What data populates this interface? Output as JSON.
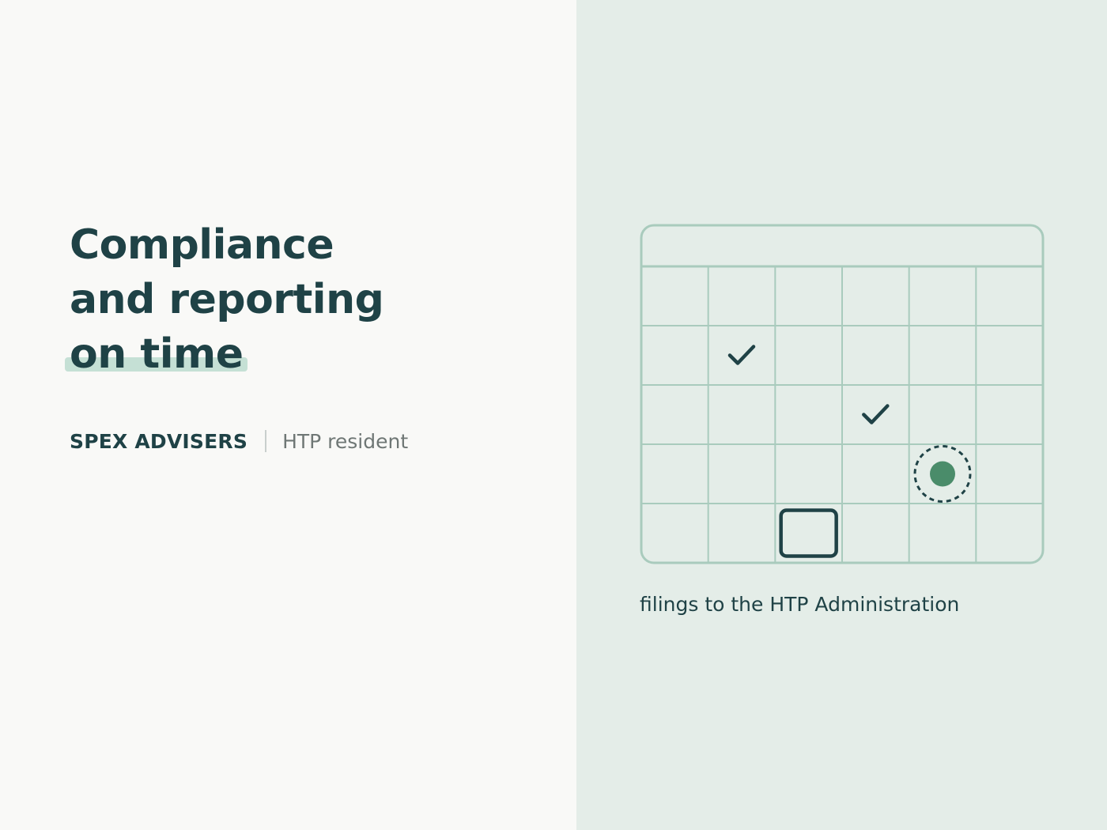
{
  "headline": {
    "line1": "Compliance",
    "line2": "and reporting",
    "line3": "on time"
  },
  "brand": {
    "name": "SPEX ADVISERS",
    "tag": "HTP resident"
  },
  "illustration": {
    "caption": "filings to the HTP Administration",
    "calendar": {
      "columns": 6,
      "rows": 5,
      "checked_cells": [
        [
          1,
          1
        ],
        [
          2,
          3
        ]
      ],
      "target_cell": [
        3,
        4
      ],
      "empty_box_cell": [
        4,
        2
      ]
    }
  },
  "colors": {
    "dark": "#1f4246",
    "accent": "#4a8c6a",
    "grid": "#a9cbbd",
    "panel": "#e4ede8",
    "highlight": "#c5e0d5"
  }
}
